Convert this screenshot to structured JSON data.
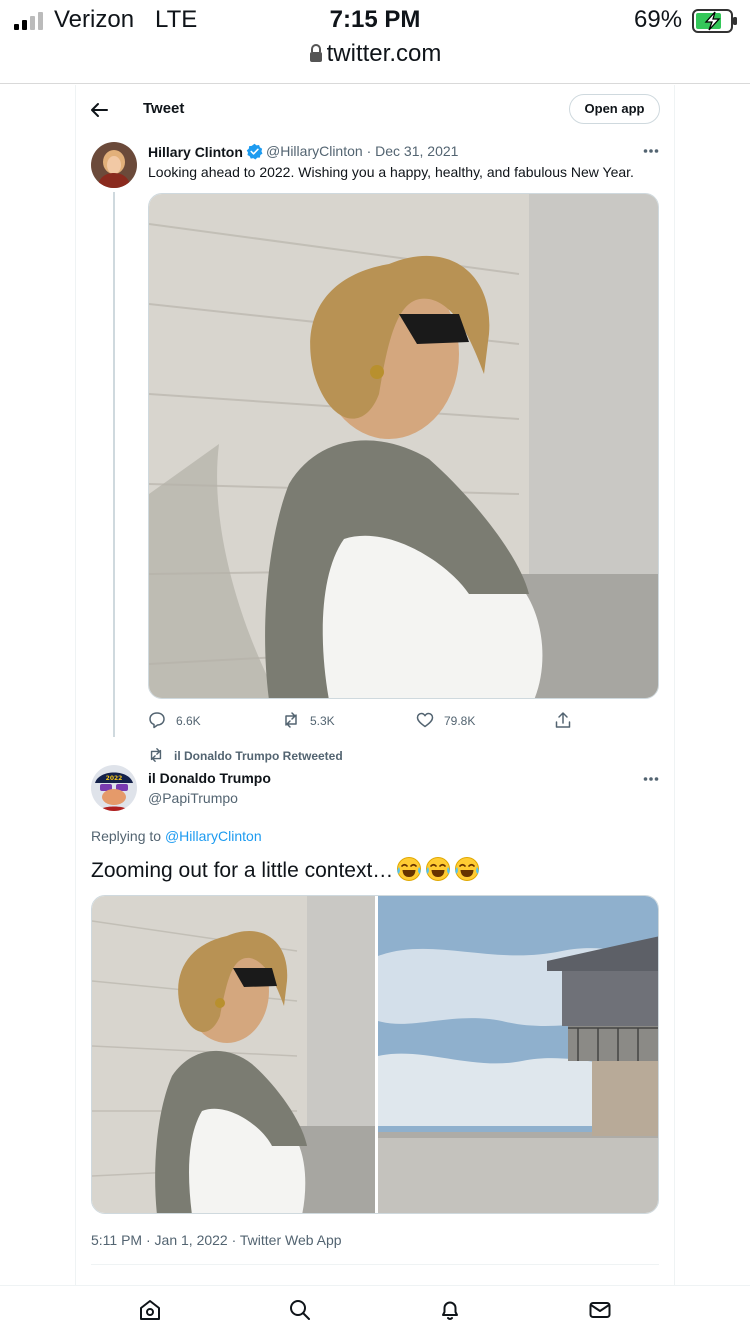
{
  "status_bar": {
    "carrier": "Verizon",
    "network": "LTE",
    "time": "7:15 PM",
    "battery_percent": "69%",
    "url": "twitter.com"
  },
  "header": {
    "back_icon": "arrow-left-icon",
    "title": "Tweet",
    "open_app_label": "Open app"
  },
  "original_tweet": {
    "author_name": "Hillary Clinton",
    "verified": true,
    "handle": "@HillaryClinton",
    "separator": "·",
    "date": "Dec 31, 2021",
    "text": "Looking ahead to 2022. Wishing you a happy, healthy, and fabulous New Year.",
    "stats": {
      "replies": "6.6K",
      "retweets": "5.3K",
      "likes": "79.8K"
    }
  },
  "retweet_note": "il Donaldo Trumpo Retweeted",
  "reply_tweet": {
    "author_name": "il Donaldo Trumpo",
    "handle": "@PapiTrumpo",
    "replying_prefix": "Replying to",
    "replying_to": "@HillaryClinton",
    "text": "Zooming out for a little context…",
    "emoji": [
      "face-with-tears-of-joy",
      "face-with-tears-of-joy",
      "face-with-tears-of-joy"
    ],
    "timestamp": "5:11 PM · Jan 1, 2022 · Twitter Web App"
  },
  "bottom_nav": [
    "home-icon",
    "search-icon",
    "notifications-icon",
    "messages-icon"
  ],
  "colors": {
    "accent": "#1d9bf0",
    "text": "#0f1419",
    "muted": "#536471",
    "border": "#cfd9de",
    "battery_charging": "#34c759"
  }
}
